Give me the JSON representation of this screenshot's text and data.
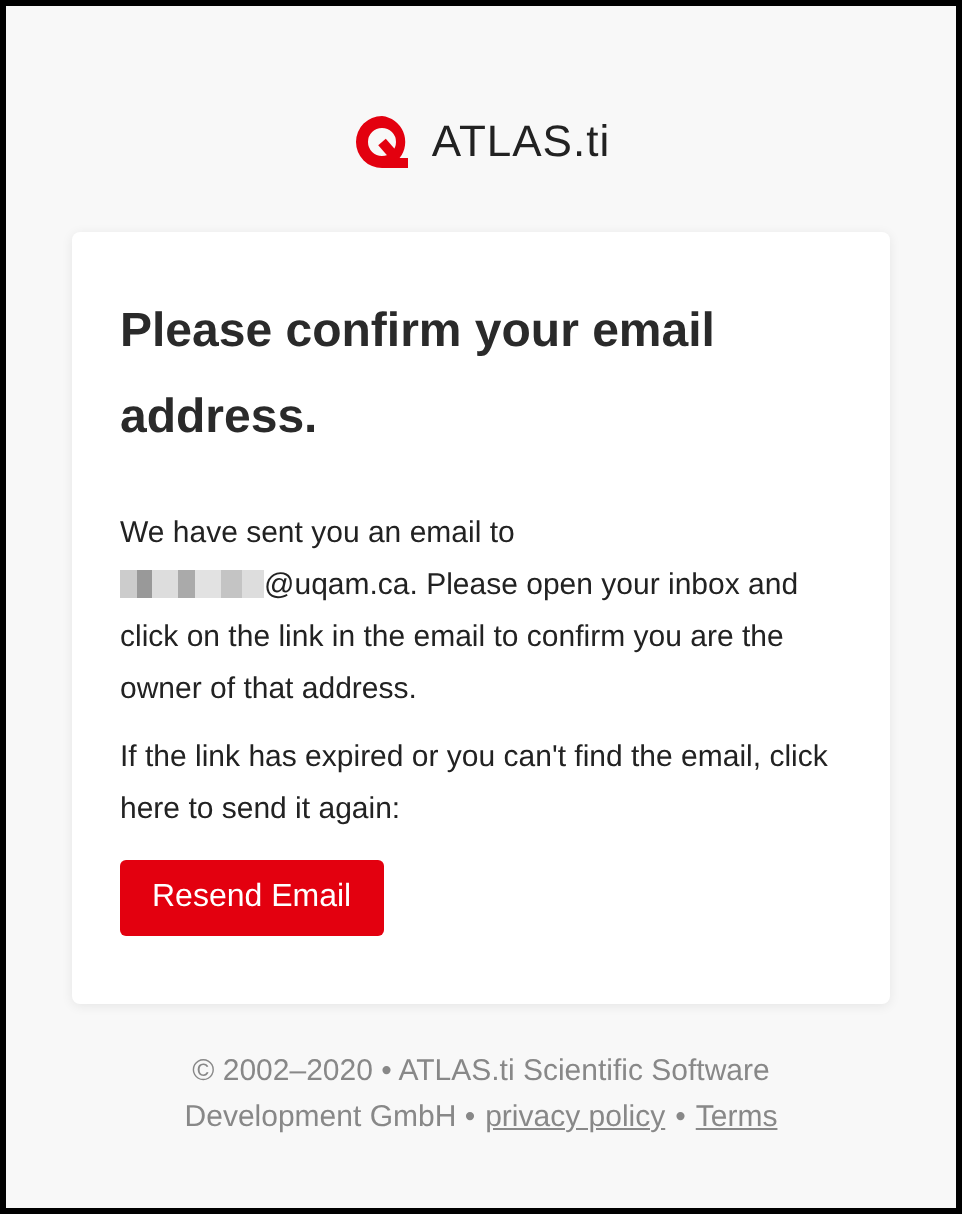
{
  "logo": {
    "text": "ATLAS.ti"
  },
  "card": {
    "title": "Please confirm your email address.",
    "paragraph_before_email": "We have sent you an email to",
    "paragraph_after_email": "@uqam.ca. Please open your inbox and click on the link in the email to confirm you are the owner of that address.",
    "resend_note": "If the link has expired or you can't find the email, click here to send it again:",
    "button": "Resend Email"
  },
  "footer": {
    "copyright_line_1": "© 2002–2020 • ATLAS.ti Scientific Software",
    "copyright_line_2": "Development GmbH •",
    "links": [
      "privacy policy",
      "Terms"
    ],
    "separator": "•"
  }
}
